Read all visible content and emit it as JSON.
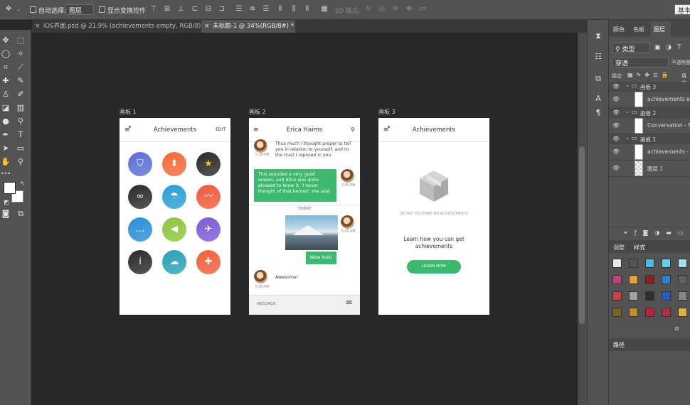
{
  "options_bar": {
    "auto_select_label": "自动选择:",
    "auto_select_value": "图层",
    "show_transform_label": "显示变换控件",
    "mode_3d_label": "3D 模式:",
    "workspace": "基本"
  },
  "tabs": [
    {
      "label": "iOS界面.psd @ 21.9% (achievements empty, RGB/8)",
      "close": "×"
    },
    {
      "label": "未标题-1 @ 34%(RGB/8#) *",
      "close": "×"
    }
  ],
  "artboards": [
    {
      "label": "画板 1",
      "title": "Achievements",
      "edit": "EDIT",
      "badges": [
        {
          "icon": "shield-icon",
          "glyph": "⛉",
          "color": "#5b6fd6"
        },
        {
          "icon": "tie-icon",
          "glyph": "⬍",
          "color": "#f26a3a"
        },
        {
          "icon": "star-icon",
          "glyph": "★",
          "color": "#2b2b2b"
        },
        {
          "icon": "infinity-icon",
          "glyph": "∞",
          "color": "#2b2b2b"
        },
        {
          "icon": "umbrella-icon",
          "glyph": "☂",
          "color": "#2a9fd6"
        },
        {
          "icon": "mustache-icon",
          "glyph": "〰",
          "color": "#f05a3c"
        },
        {
          "icon": "chat-icon",
          "glyph": "…",
          "color": "#2a8fd6"
        },
        {
          "icon": "megaphone-icon",
          "glyph": "◀",
          "color": "#8cc63f"
        },
        {
          "icon": "plane-icon",
          "glyph": "✈",
          "color": "#7b5bd6"
        },
        {
          "icon": "info-icon",
          "glyph": "i",
          "color": "#2b2b2b"
        },
        {
          "icon": "cloud-icon",
          "glyph": "☁",
          "color": "#2aa2b8"
        },
        {
          "icon": "gamepad-icon",
          "glyph": "✚",
          "color": "#f0603a"
        }
      ]
    },
    {
      "label": "画板 2",
      "title": "Erica Haims",
      "messages": [
        {
          "text": "Thus much I thought proper to tell you in relation to yourself, and to the trust I reposed in you.",
          "time": "5:00 PM"
        },
        {
          "text": "This sounded a very good reason, and Alice was quite pleased to know it. 'I never thought of that before!' she said.",
          "time": "5:00 PM"
        },
        {
          "text": "Wow look!",
          "time": ""
        },
        {
          "text": "Awesome!",
          "time": "5:00 PM"
        }
      ],
      "photo_time": "5:00 PM",
      "divider": "TODAY",
      "composer_placeholder": "MESSAGE"
    },
    {
      "label": "画板 3",
      "title": "Achievements",
      "empty_caption": "OH NO! YOU HAVE NO ACHIEVEMENTS",
      "empty_heading": "Learn how you can get achievements",
      "button": "LEARN HOW"
    }
  ],
  "panel": {
    "tabs": [
      "颜色",
      "色板",
      "图层"
    ],
    "kind_filter": "类型",
    "blend_mode": "穿透",
    "opacity_label": "不透明度",
    "lock_label": "锁定:",
    "fill_label": "填充",
    "layers": [
      {
        "name": "画板 3",
        "group": true
      },
      {
        "name": "achievements empty",
        "group": false
      },
      {
        "name": "画板 2",
        "group": true
      },
      {
        "name": "Conversation - S",
        "group": false
      },
      {
        "name": "画板 1",
        "group": true
      },
      {
        "name": "achievements - ",
        "group": false
      },
      {
        "name": "图层 1",
        "group": false
      }
    ],
    "adjust_tabs": [
      "调整",
      "样式"
    ],
    "paths_tab": "路径"
  },
  "colors": {
    "accent_green": "#3cb96e",
    "ps_panel": "#535353",
    "ps_canvas": "#282828"
  }
}
